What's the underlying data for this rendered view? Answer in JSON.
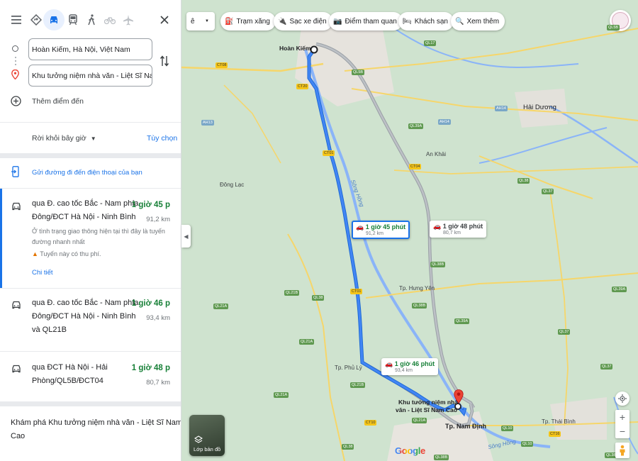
{
  "sidebar": {
    "origin_value": "Hoàn Kiếm, Hà Nội, Việt Nam",
    "destination_value": "Khu tưởng niệm nhà văn - Liệt Sĩ Nam Cao",
    "add_destination": "Thêm điểm đến",
    "depart_now": "Rời khỏi bây giờ",
    "options": "Tùy chọn",
    "send_to_phone": "Gửi đường đi đến điện thoại của bạn",
    "routes": [
      {
        "line1": "qua Đ. cao tốc Bắc - Nam phía",
        "line2": "Đông/ĐCT Hà Nội - Ninh Bình",
        "time": "1 giờ 45 p",
        "distance": "91,2 km",
        "traffic1": "Ở tình trạng giao thông hiện tại thì đây là tuyến",
        "traffic2": "đường nhanh nhất",
        "warning": "Tuyến này có thu phí.",
        "details": "Chi tiết"
      },
      {
        "line1": "qua Đ. cao tốc Bắc - Nam phía",
        "line2": "Đông/ĐCT Hà Nội - Ninh Bình",
        "line3": "và QL21B",
        "time": "1 giờ 46 p",
        "distance": "93,4 km"
      },
      {
        "line1": "qua ĐCT Hà Nội - Hải",
        "line2": "Phòng/QL5B/ĐCT04",
        "time": "1 giờ 48 p",
        "distance": "80,7 km"
      }
    ],
    "explore1": "Khám phá Khu tưởng niệm nhà văn - Liệt Sĩ Nam",
    "explore2": "Cao"
  },
  "map": {
    "chips": [
      "Trạm xăng",
      "Sạc xe điện",
      "Điểm tham quan",
      "Khách sạn",
      "Xem thêm"
    ],
    "lang_button": "ê",
    "places": {
      "hoan_kiem": "Hoàn Kiếm",
      "hai_duong": "Hải Dương",
      "dong_lac": "Đông Lạc",
      "an_khai": "An Khải",
      "hung_yen": "Tp. Hưng Yên",
      "hung_yen_road": "QL39A",
      "phu_ly": "Tp. Phủ Lý",
      "nam_dinh": "Tp. Nam Định",
      "thai_binh": "Tp. Thái Bình",
      "song_hong": "Sông Hồng",
      "song_hong2": "Sông Hồng",
      "dest1": "Khu tưởng niệm nhà",
      "dest2": "văn - Liệt Sĩ Nam Cao"
    },
    "roads": [
      "QL17",
      "CT08",
      "QL5B",
      "CT20",
      "AH14",
      "AH13",
      "QL39A",
      "AH14",
      "CT01",
      "CT04",
      "QL38",
      "QL37",
      "QL38B",
      "QL21B",
      "CT01",
      "QL38",
      "QL21A",
      "QL38B",
      "QL21A",
      "QL39A",
      "QL37",
      "QL21B",
      "QL10",
      "QL21A",
      "CT10",
      "QL38B",
      "QL38",
      "QL21A",
      "QL10",
      "CT16",
      "QL39A",
      "QL37",
      "QL5B",
      "QL38B"
    ],
    "callouts": [
      {
        "time": "1 giờ 45 phút",
        "dist": "91,2 km"
      },
      {
        "time": "1 giờ 48 phút",
        "dist": "80,7 km"
      },
      {
        "time": "1 giờ 46 phút",
        "dist": "93,4 km"
      }
    ],
    "layer_label": "Lớp bản đồ",
    "google": "Google"
  }
}
